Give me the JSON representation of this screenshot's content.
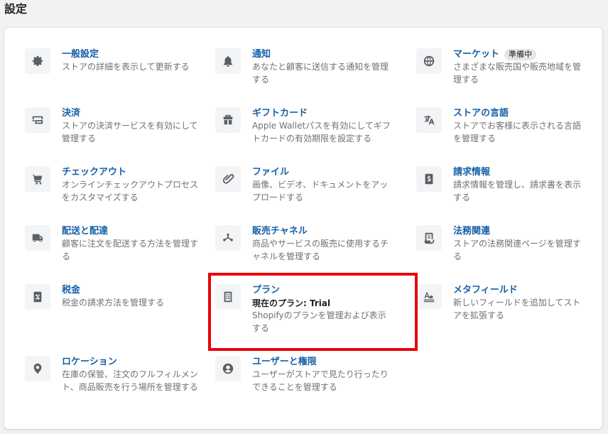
{
  "page": {
    "title": "設定"
  },
  "items": [
    {
      "id": "general",
      "label": "一般設定",
      "desc": "ストアの詳細を表示して更新する",
      "icon": "gear-icon"
    },
    {
      "id": "notifications",
      "label": "通知",
      "desc": "あなたと顧客に送信する通知を管理する",
      "icon": "bell-icon"
    },
    {
      "id": "markets",
      "label": "マーケット",
      "badge": "準備中",
      "desc": "さまざまな販売国や販売地域を管理する",
      "icon": "globe-icon"
    },
    {
      "id": "payments",
      "label": "決済",
      "desc": "ストアの決済サービスを有効にして管理する",
      "icon": "payment-icon"
    },
    {
      "id": "gift-cards",
      "label": "ギフトカード",
      "desc": "Apple Walletパスを有効にしてギフトカードの有効期限を設定する",
      "icon": "gift-icon"
    },
    {
      "id": "store-languages",
      "label": "ストアの言語",
      "desc": "ストアでお客様に表示される言語を管理する",
      "icon": "translate-icon"
    },
    {
      "id": "checkout",
      "label": "チェックアウト",
      "desc": "オンラインチェックアウトプロセスをカスタマイズする",
      "icon": "cart-icon"
    },
    {
      "id": "files",
      "label": "ファイル",
      "desc": "画像、ビデオ、ドキュメントをアップロードする",
      "icon": "paperclip-icon"
    },
    {
      "id": "billing",
      "label": "請求情報",
      "desc": "請求情報を管理し、請求書を表示する",
      "icon": "dollar-document-icon"
    },
    {
      "id": "shipping",
      "label": "配送と配達",
      "desc": "顧客に注文を配送する方法を管理する",
      "icon": "truck-icon"
    },
    {
      "id": "sales-channels",
      "label": "販売チャネル",
      "desc": "商品やサービスの販売に使用するチャネルを管理する",
      "icon": "channels-icon"
    },
    {
      "id": "legal",
      "label": "法務関連",
      "desc": "ストアの法務関連ページを管理する",
      "icon": "legal-document-icon"
    },
    {
      "id": "taxes",
      "label": "税金",
      "desc": "税金の請求方法を管理する",
      "icon": "percent-icon"
    },
    {
      "id": "plan",
      "label": "プラン",
      "sub": "現在のプラン: Trial",
      "desc": "Shopifyのプランを管理および表示する",
      "icon": "plan-icon"
    },
    {
      "id": "metafields",
      "label": "メタフィールド",
      "desc": "新しいフィールドを追加してストアを拡張する",
      "icon": "metafields-icon"
    },
    {
      "id": "locations",
      "label": "ロケーション",
      "desc": "在庫の保管、注文のフルフィルメント、商品販売を行う場所を管理する",
      "icon": "location-pin-icon"
    },
    {
      "id": "users",
      "label": "ユーザーと権限",
      "desc": "ユーザーがストアで見たり行ったりできることを管理する",
      "icon": "user-icon"
    }
  ],
  "colors": {
    "link": "#1560a6",
    "highlight": "#e8000b",
    "background": "#f1f2f4"
  }
}
